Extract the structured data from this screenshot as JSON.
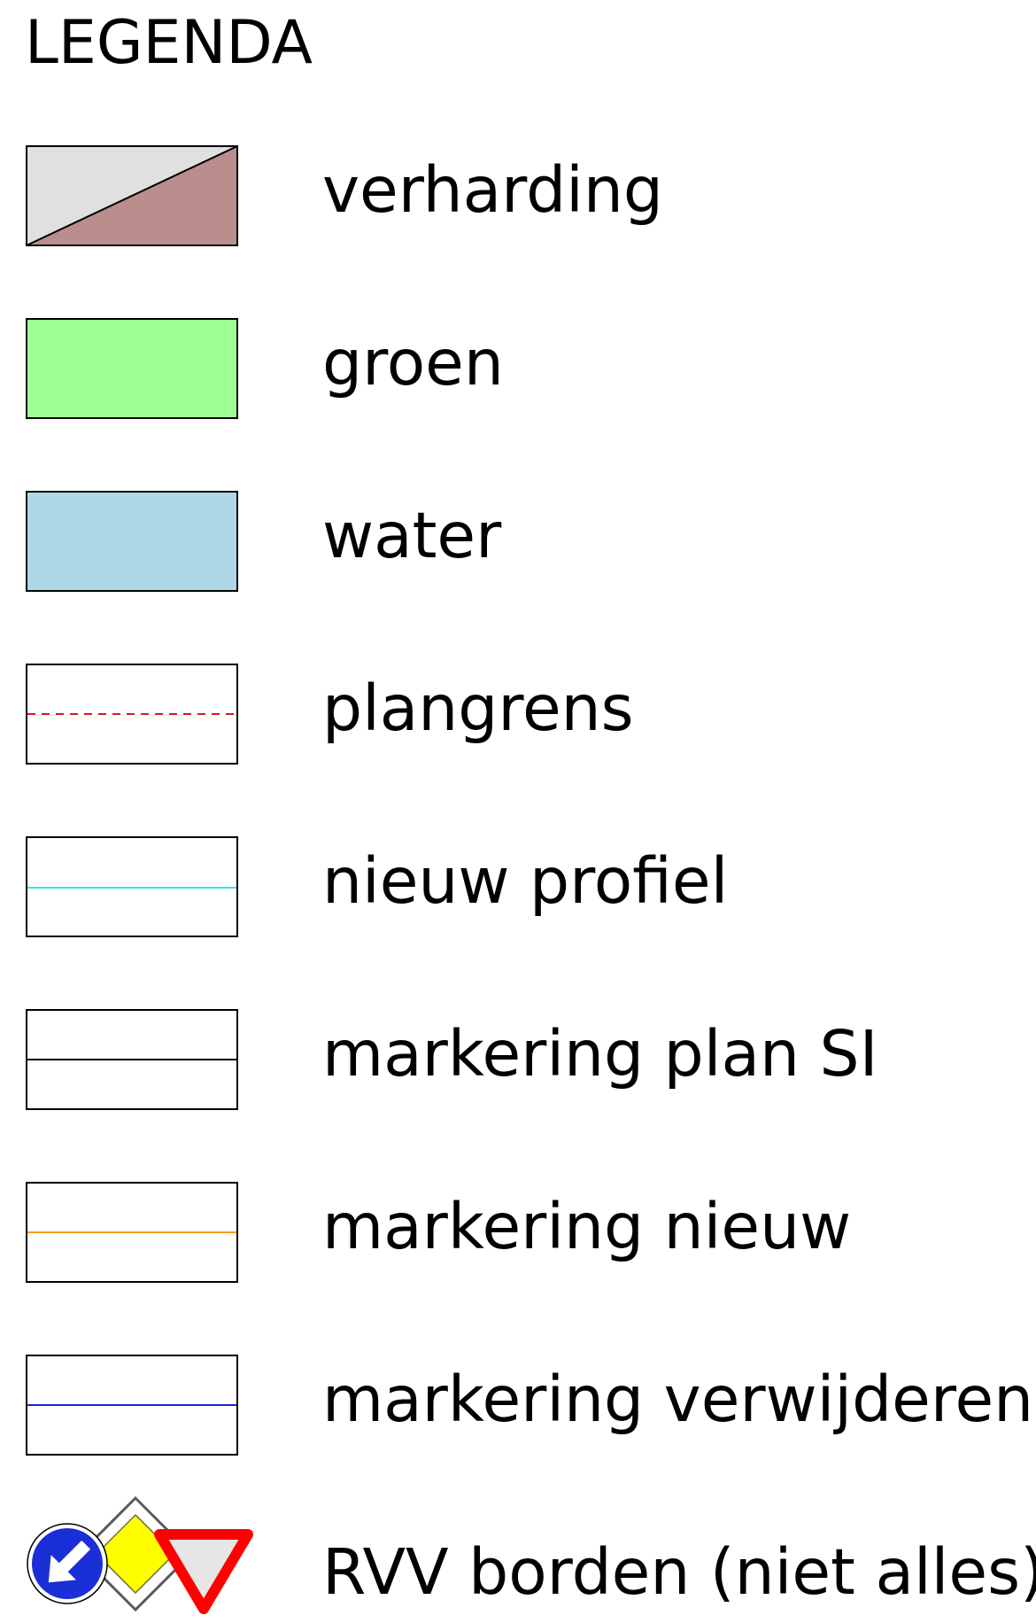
{
  "legend": {
    "title": "LEGENDA",
    "items": [
      {
        "key": "verharding",
        "label": "verharding",
        "swatch": "split-diagonal",
        "colors": {
          "upper": "#e0e0e0",
          "lower": "#b98e8c",
          "border": "#000000"
        }
      },
      {
        "key": "groen",
        "label": "groen",
        "swatch": "fill",
        "colors": {
          "fill": "#9eff94",
          "border": "#000000"
        }
      },
      {
        "key": "water",
        "label": "water",
        "swatch": "fill",
        "colors": {
          "fill": "#add8e6",
          "border": "#000000"
        }
      },
      {
        "key": "plangrens",
        "label": "plangrens",
        "swatch": "dashed-line",
        "colors": {
          "line": "#e0141e",
          "border": "#000000"
        }
      },
      {
        "key": "nieuw-profiel",
        "label": "nieuw profiel",
        "swatch": "solid-line",
        "colors": {
          "line": "#33e8e8",
          "border": "#000000"
        }
      },
      {
        "key": "markering-plan-si",
        "label": "markering plan SI",
        "swatch": "solid-line",
        "colors": {
          "line": "#000000",
          "border": "#000000"
        }
      },
      {
        "key": "markering-nieuw",
        "label": "markering nieuw",
        "swatch": "solid-line",
        "colors": {
          "line": "#ff9a1a",
          "border": "#000000"
        }
      },
      {
        "key": "markering-verwijderen",
        "label": "markering verwijderen",
        "swatch": "solid-line",
        "colors": {
          "line": "#2424d4",
          "border": "#000000"
        }
      },
      {
        "key": "rvv-borden",
        "label": "RVV borden (niet alles)",
        "swatch": "traffic-signs",
        "icons": [
          "keep-right-sign-icon",
          "priority-road-sign-icon",
          "yield-sign-icon"
        ],
        "colors": {
          "blue": "#1a2fd6",
          "yellow": "#ffff00",
          "red": "#ff0000",
          "grey": "#e6e6e6"
        }
      }
    ]
  }
}
